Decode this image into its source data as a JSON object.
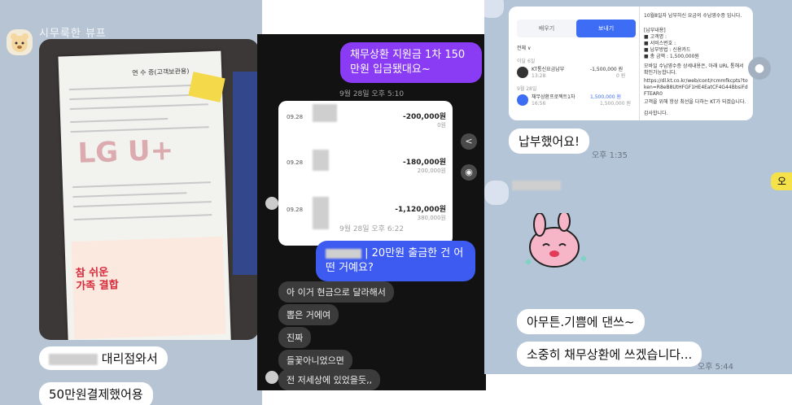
{
  "left_chat": {
    "sender_name": "시무룩한 뷰프",
    "photo": {
      "doc_header": "연 수 증(고객보관용)",
      "watermark": "LG U+",
      "promo_text": "참 쉬운 가족 결합"
    },
    "messages": [
      {
        "text": "대리점와서"
      },
      {
        "text": "50만원결제했어용"
      }
    ]
  },
  "middle_chat": {
    "sent_top": "채무상환 지원금 1차 150만원 입금됐대요~",
    "date_1": "9월 28일 오후 5:10",
    "transactions": [
      {
        "date": "09.28",
        "amount": "-200,000원",
        "balance": "0원"
      },
      {
        "date": "09.28",
        "amount": "-180,000원",
        "balance": "200,000원"
      },
      {
        "date": "09.28",
        "amount": "-1,120,000원",
        "balance": "380,000원"
      }
    ],
    "date_2": "9월 28일 오후 6:22",
    "sent_question": "| 20만원 출금한 건 어떤 거예요?",
    "received": [
      "아 이거 현금으로 달라해서",
      "뽑은 거에여",
      "진짜",
      "들꽃아니었으면",
      "전 저세상에 있었을듯,,"
    ],
    "icons": {
      "share": "share-icon",
      "camera": "camera-icon"
    }
  },
  "right_chat": {
    "screenshot": {
      "tab_receive": "배우기",
      "tab_send": "보내기",
      "filter": "전체 ∨",
      "section_1": "이달 6일",
      "tx1_name": "KT통신요금납부",
      "tx1_time": "13:28",
      "tx1_amount": "-1,500,000 원",
      "tx1_balance": "0 원",
      "section_2": "9월 28일",
      "tx2_name": "채무상환프로젝트1차",
      "tx2_time": "16:56",
      "tx2_amount": "1,500,000 원",
      "tx2_balance": "1,500,000 원",
      "notice_title": "10월8일자 납부하신 요금의 수납영수증 입니다.",
      "notice_lines": [
        "[납부내용]",
        "■ 고객명 :",
        "■ 서비스번호 :",
        "■ 납부방법 : 신용카드",
        "■ 총 금액 : 1,500,000원"
      ],
      "notice_body": "모바일 수납영수증 상세내용은, 아래 URL 통해서 확인가능합니다.",
      "notice_url": "https://dl.kt.co.kr/web/cont/rcmmfkcpts?token=R8eB8UtHFGF1HE4EatCF4G44BbsiFdFTEAR0",
      "notice_footer": "고객을 위해 항상 최선을 다하는 KT가 되겠습니다.",
      "notice_thanks": "감사합니다."
    },
    "messages": [
      {
        "text": "납부했어요!",
        "time": "오후 1:35"
      },
      {
        "text": "아무튼.기쁨에 댄쓰~"
      },
      {
        "text": "소중히 채무상환에 쓰겠습니다...",
        "time": "오후 5:44"
      }
    ],
    "edge_badge": "오"
  },
  "colors": {
    "left_bg": "#b6c4d3",
    "middle_bg": "#121212",
    "sent_purple": "#8a3cf5",
    "sent_blue": "#3d5af1",
    "right_bg": "#b4c5d8"
  }
}
